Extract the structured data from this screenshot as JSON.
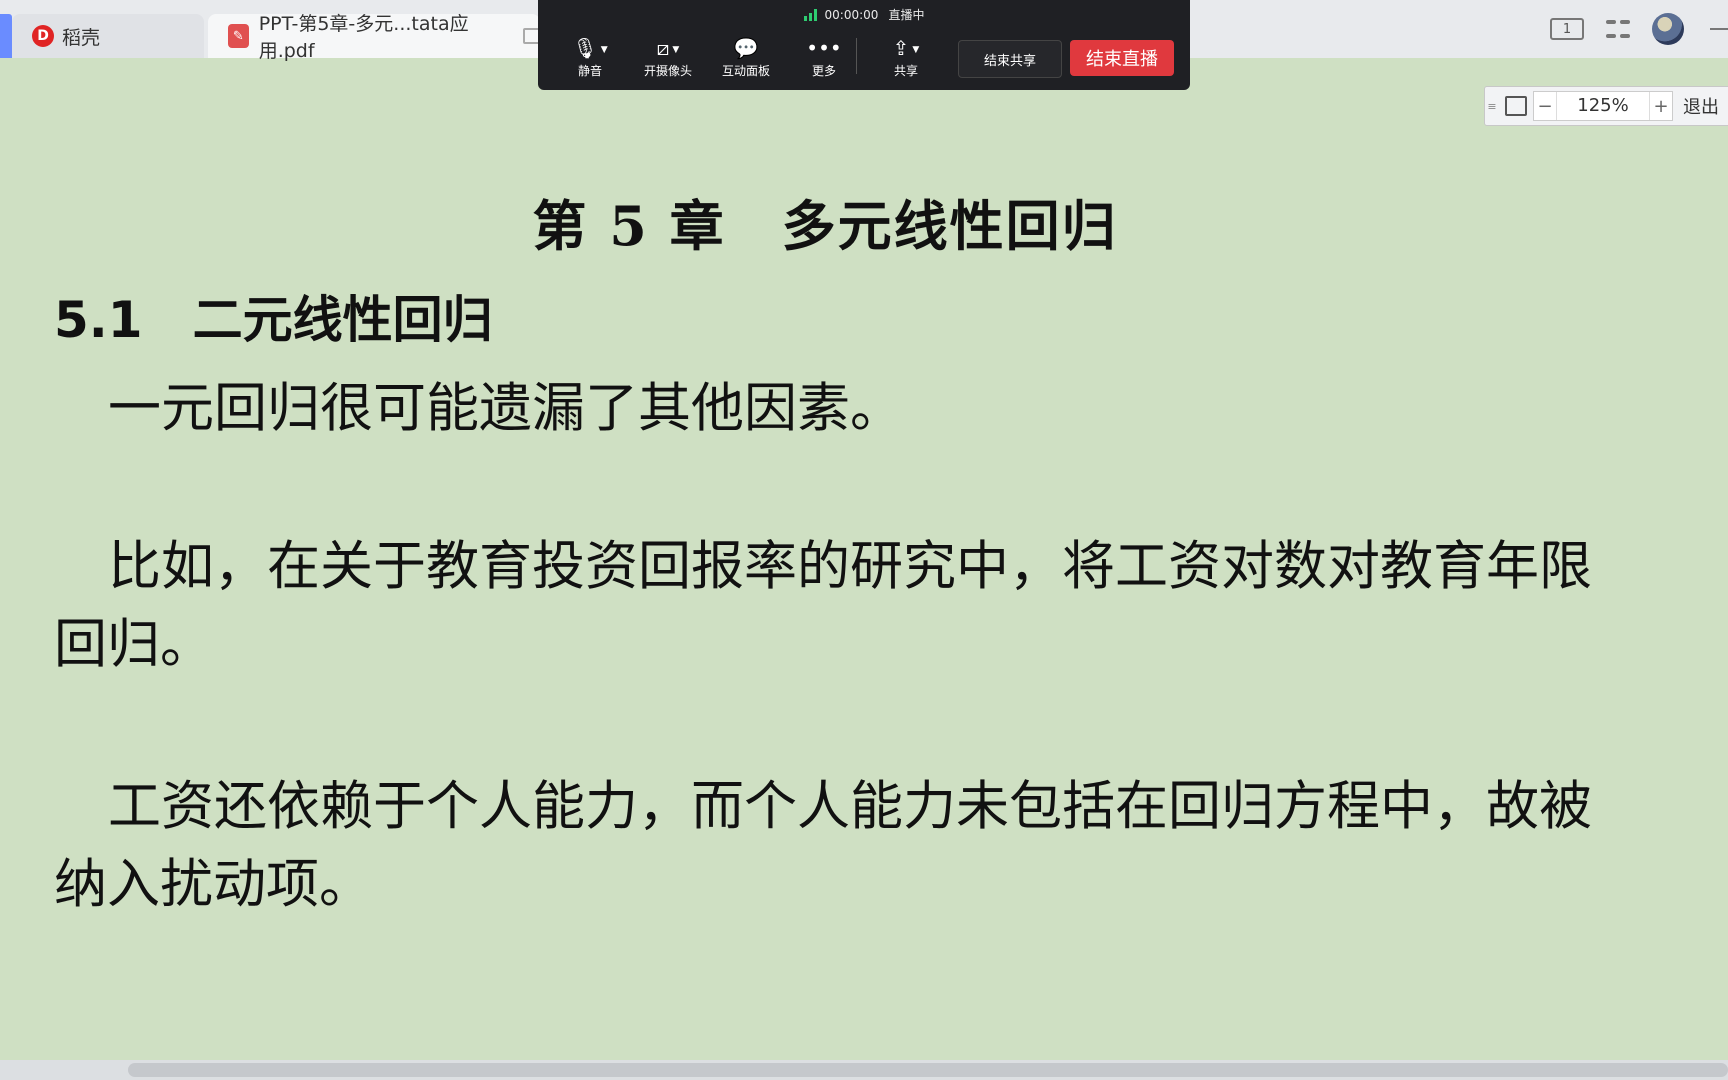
{
  "tabs": {
    "app_name": "稻壳",
    "doc_title": "PPT-第5章-多元...tata应用.pdf"
  },
  "meeting": {
    "timer": "00:00:00",
    "live_status": "直播中",
    "buttons": {
      "mute": "静音",
      "camera": "开摄像头",
      "whiteboard": "互动面板",
      "more": "更多",
      "share": "共享"
    },
    "end_share": "结束共享",
    "end_live": "结束直播",
    "colors": {
      "end_live_bg": "#e0393e",
      "signal": "#2ecc71"
    }
  },
  "topbar": {
    "page_indicator": "1",
    "icons": [
      "single-page-view-icon",
      "grid-view-icon",
      "avatar",
      "minimize-icon"
    ]
  },
  "zoom": {
    "value": "125%",
    "exit_label": "退出"
  },
  "document": {
    "chapter_title": "第 5 章　多元线性回归",
    "section_title": "5.1　二元线性回归",
    "paragraphs": [
      "一元回归很可能遗漏了其他因素。",
      "比如，在关于教育投资回报率的研究中，将工资对数对教育年限回归。",
      "工资还依赖于个人能力，而个人能力未包括在回归方程中，故被纳入扰动项。"
    ],
    "background_color": "#cfe0c3"
  }
}
